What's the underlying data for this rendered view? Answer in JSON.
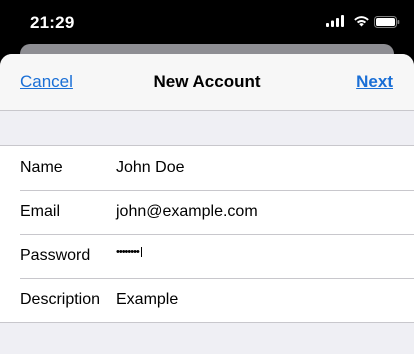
{
  "status_bar": {
    "time": "21:29",
    "icons": [
      "signal-icon",
      "wifi-icon",
      "battery-icon"
    ]
  },
  "nav": {
    "cancel_label": "Cancel",
    "title": "New Account",
    "next_label": "Next"
  },
  "form": {
    "rows": [
      {
        "label": "Name",
        "value": "John Doe"
      },
      {
        "label": "Email",
        "value": "john@example.com"
      },
      {
        "label": "Password",
        "value": "••••••••"
      },
      {
        "label": "Description",
        "value": "Example"
      }
    ]
  },
  "colors": {
    "accent": "#1a6fd6",
    "nav_background": "#f7f7f7",
    "grouped_background": "#efeff4",
    "separator": "#c8c7cc"
  }
}
